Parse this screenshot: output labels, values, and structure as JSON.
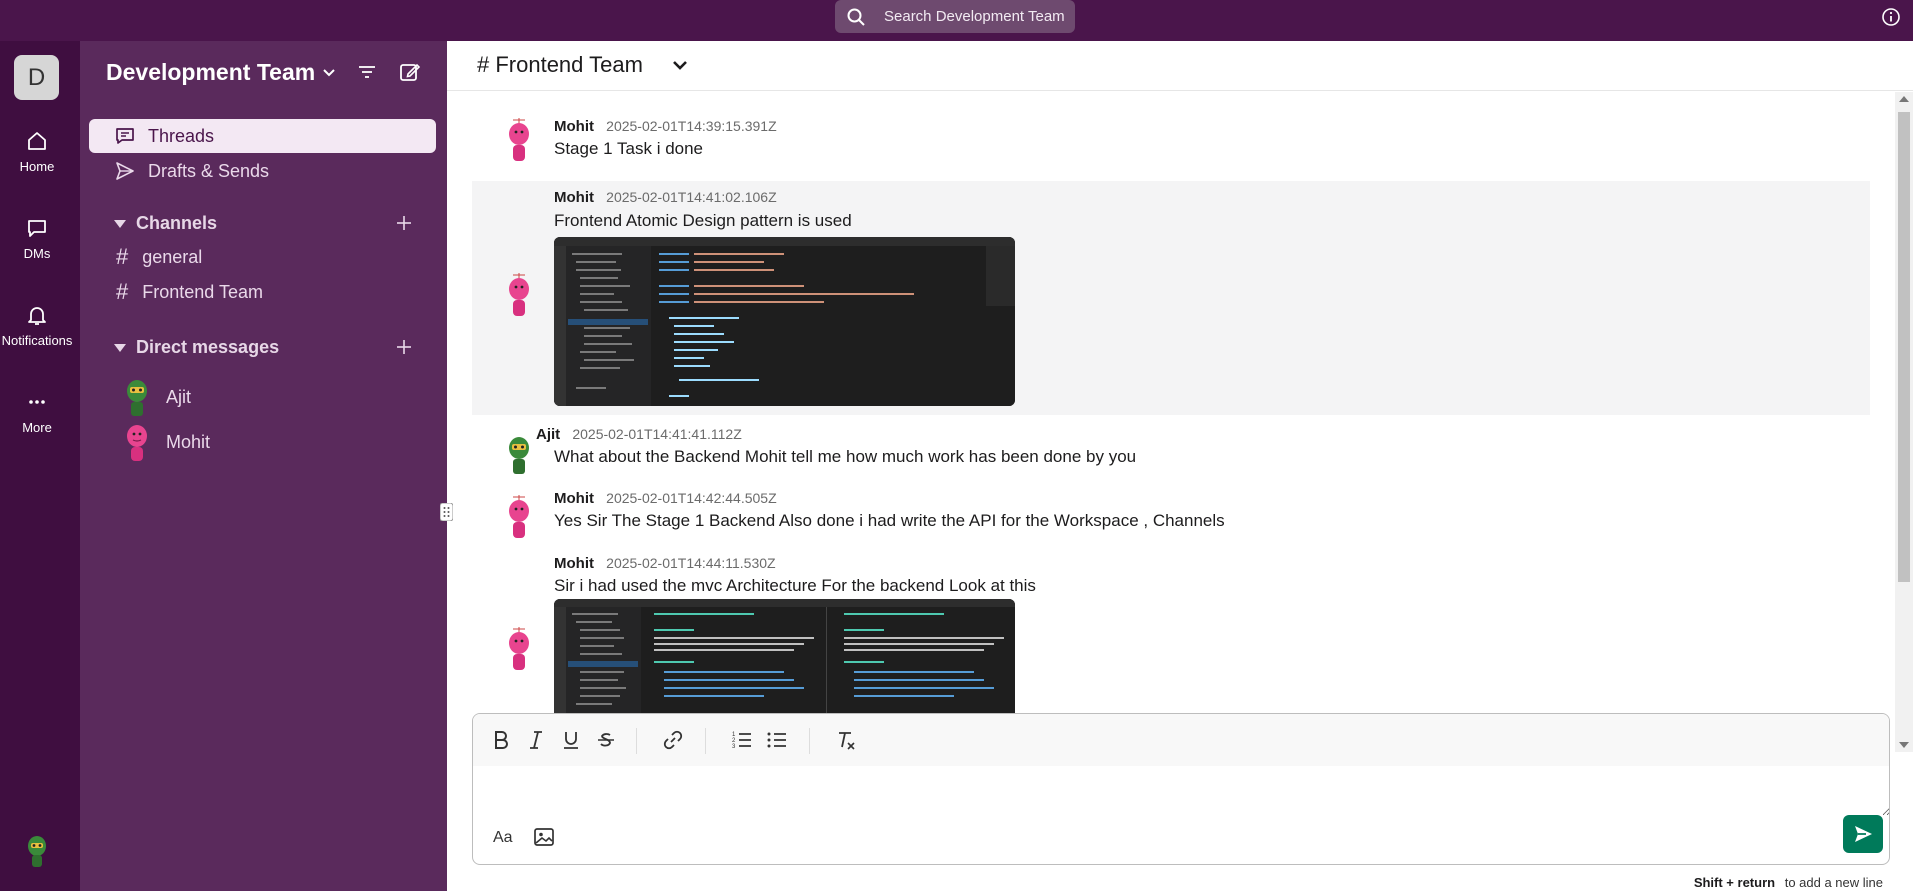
{
  "search": {
    "label": "Search Development Team"
  },
  "rail": {
    "workspace_initial": "D",
    "items": [
      {
        "label": "Home",
        "icon": "home-icon"
      },
      {
        "label": "DMs",
        "icon": "message-icon"
      },
      {
        "label": "Notifications",
        "icon": "bell-icon"
      },
      {
        "label": "More",
        "icon": "ellipsis-icon"
      }
    ]
  },
  "sidebar": {
    "workspace_name": "Development Team",
    "nav": [
      {
        "label": "Threads",
        "icon": "threads-icon",
        "active": true
      },
      {
        "label": "Drafts & Sends",
        "icon": "send-icon",
        "active": false
      }
    ],
    "channels_heading": "Channels",
    "channels": [
      "general",
      "Frontend Team"
    ],
    "dm_heading": "Direct messages",
    "dms": [
      {
        "name": "Ajit",
        "avatar": "green-avatar"
      },
      {
        "name": "Mohit",
        "avatar": "pink-avatar"
      }
    ]
  },
  "channel": {
    "title": "# Frontend Team"
  },
  "messages": [
    {
      "author": "Mohit",
      "time": "2025-02-01T14:39:15.391Z",
      "text": "Stage 1 Task i done"
    },
    {
      "author": "Mohit",
      "time": "2025-02-01T14:41:02.106Z",
      "text": "Frontend Atomic Design pattern is used",
      "has_image": true
    },
    {
      "author": "Ajit",
      "time": "2025-02-01T14:41:41.112Z",
      "text": "What about the Backend Mohit tell me how much work has been done by you"
    },
    {
      "author": "Mohit",
      "time": "2025-02-01T14:42:44.505Z",
      "text": "Yes Sir The Stage 1 Backend Also done i had write the API for the Workspace , Channels"
    },
    {
      "author": "Mohit",
      "time": "2025-02-01T14:44:11.530Z",
      "text": "Sir i had used the mvc Architecture For the backend Look at this",
      "has_image": true
    }
  ],
  "composer": {
    "placeholder": "",
    "aa_label": "Aa",
    "hint_keys": "Shift + return",
    "hint_text": "to add a new line"
  },
  "colors": {
    "topbar": "#4a154b",
    "rail": "#3f0e40",
    "sidebar": "#5a2a5c",
    "send": "#007a5a"
  }
}
